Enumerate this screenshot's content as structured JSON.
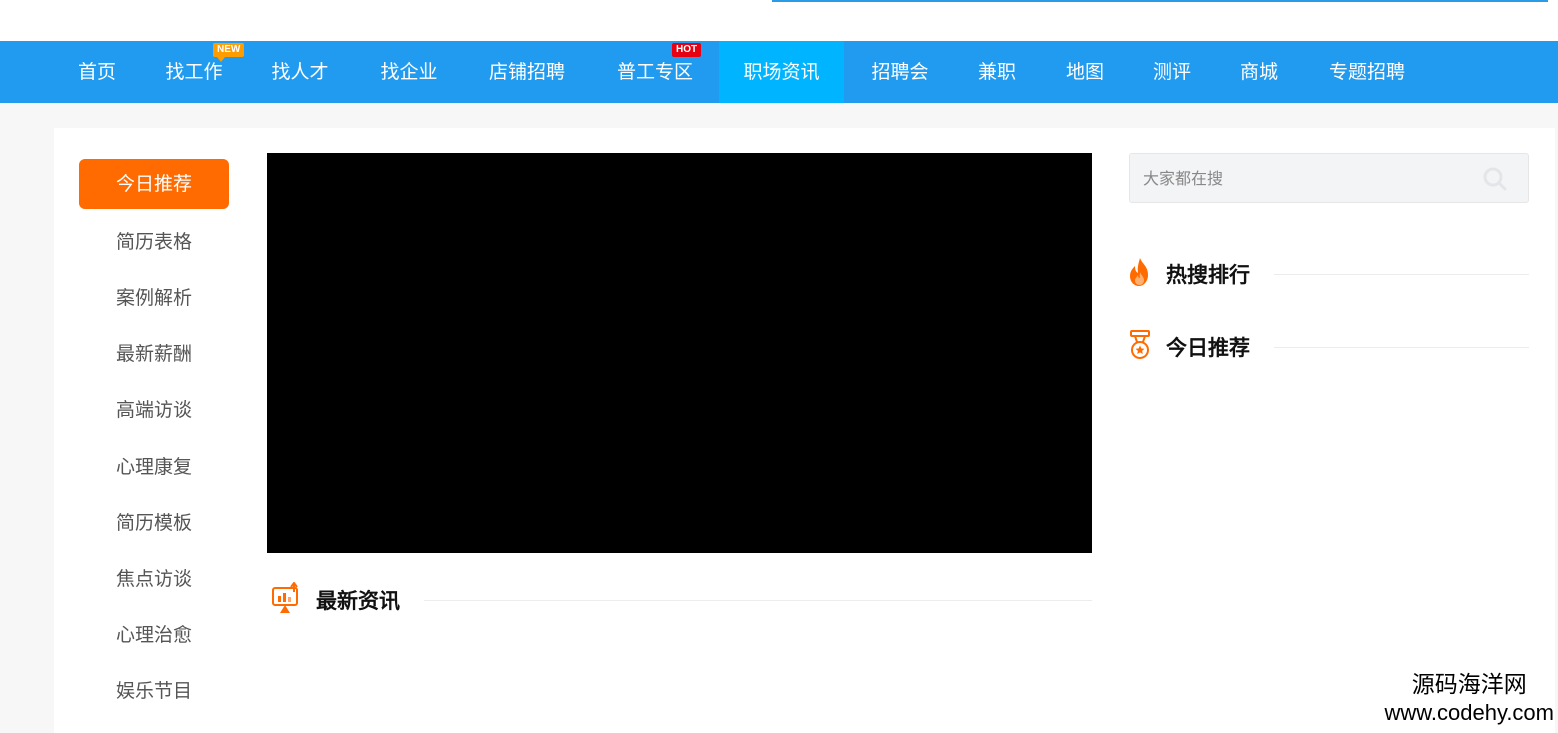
{
  "nav": {
    "items": [
      {
        "label": "首页"
      },
      {
        "label": "找工作",
        "badge": "NEW"
      },
      {
        "label": "找人才"
      },
      {
        "label": "找企业"
      },
      {
        "label": "店铺招聘"
      },
      {
        "label": "普工专区",
        "badge": "HOT"
      },
      {
        "label": "职场资讯",
        "active": true
      },
      {
        "label": "招聘会"
      },
      {
        "label": "兼职"
      },
      {
        "label": "地图"
      },
      {
        "label": "测评"
      },
      {
        "label": "商城"
      },
      {
        "label": "专题招聘"
      }
    ]
  },
  "sidebar": {
    "items": [
      {
        "label": "今日推荐",
        "active": true
      },
      {
        "label": "简历表格"
      },
      {
        "label": "案例解析"
      },
      {
        "label": "最新薪酬"
      },
      {
        "label": "高端访谈"
      },
      {
        "label": "心理康复"
      },
      {
        "label": "简历模板"
      },
      {
        "label": "焦点访谈"
      },
      {
        "label": "心理治愈"
      },
      {
        "label": "娱乐节目"
      }
    ]
  },
  "main": {
    "latest_news_title": "最新资讯"
  },
  "right": {
    "search_placeholder": "大家都在搜",
    "hot_search_title": "热搜排行",
    "today_recommend_title": "今日推荐"
  },
  "watermark": {
    "line1": "源码海洋网",
    "line2": "www.codehy.com"
  },
  "colors": {
    "nav_bg": "#219bf0",
    "nav_active": "#00b4ff",
    "accent_orange": "#ff6b00",
    "badge_new": "#ff9c00",
    "badge_hot": "#e60012"
  },
  "icons": {
    "latest_news": "chart-presentation-icon",
    "hot_search": "flame-icon",
    "today_recommend": "medal-icon",
    "search": "search-icon"
  }
}
